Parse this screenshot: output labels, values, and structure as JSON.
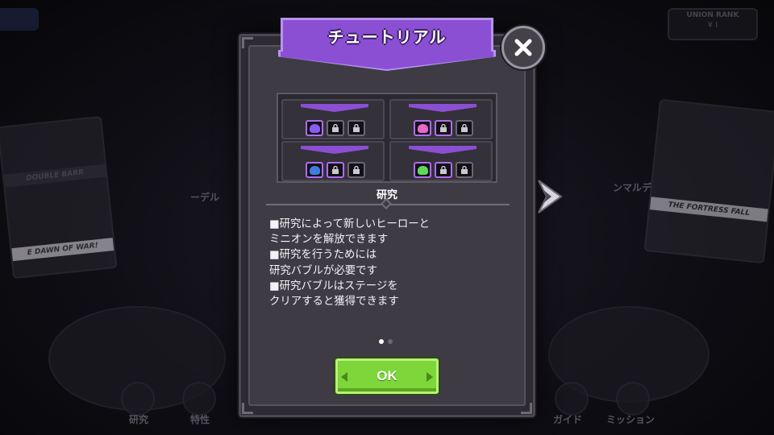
{
  "background": {
    "top_right_badge_label": "UNION RANK",
    "top_right_badge_value": "¥ I",
    "left_card_band": "DOUBLE BARR",
    "left_card_title": "E DAWN OF WAR!",
    "left_card_label": "ーデル",
    "right_card_title": "THE FORTRESS FALL",
    "right_card_label": "ンマルデ",
    "bottom_nav": [
      "研究",
      "特性",
      "ガイド",
      "ミッション"
    ]
  },
  "modal": {
    "title": "チュートリアル",
    "section_caption": "研究",
    "description_lines": [
      "■研究によって新しいヒーローと",
      "ミニオンを解放できます",
      "■研究を行うためには",
      "研究バブルが必要です",
      "■研究バブルはステージを",
      "クリアすると獲得できます"
    ],
    "ok_label": "OK",
    "pager": {
      "current": 1,
      "total": 2
    }
  },
  "icons": {
    "close": "close-icon",
    "next": "chevron-right-icon",
    "lock": "lock-icon"
  },
  "colors": {
    "accent_purple": "#8b4fd3",
    "ok_green": "#7dd63a",
    "panel": "#3e3b45"
  },
  "preview_trees": [
    {
      "slots": [
        {
          "type": "blob",
          "color": "#8a5cf0"
        },
        {
          "type": "lock"
        },
        {
          "type": "lock"
        }
      ]
    },
    {
      "slots": [
        {
          "type": "blob",
          "color": "#e868c8"
        },
        {
          "type": "lock"
        },
        {
          "type": "lock"
        }
      ]
    },
    {
      "slots": [
        {
          "type": "blob",
          "color": "#3f7be0"
        },
        {
          "type": "lock"
        },
        {
          "type": "lock"
        }
      ]
    },
    {
      "slots": [
        {
          "type": "blob",
          "color": "#5ed85a"
        },
        {
          "type": "lock"
        },
        {
          "type": "lock"
        }
      ]
    }
  ]
}
